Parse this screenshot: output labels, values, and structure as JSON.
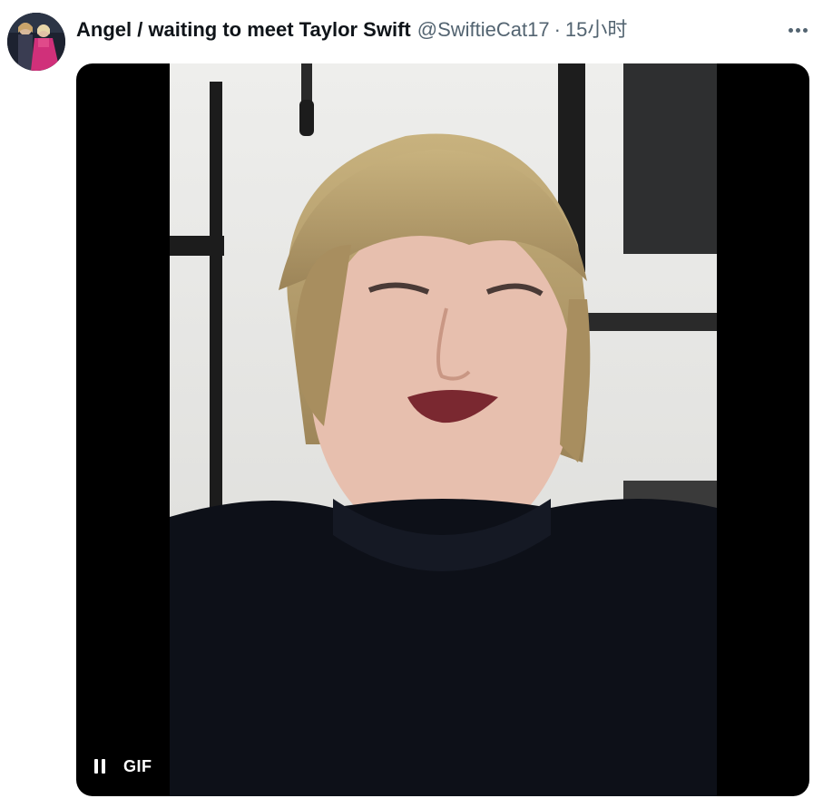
{
  "tweet": {
    "author_name": "Angel / waiting to meet Taylor Swift",
    "handle": "@SwiftieCat17",
    "separator": "·",
    "timestamp": "15小时",
    "more_icon": "more-horizontal-icon"
  },
  "media": {
    "type": "gif",
    "badge": "GIF",
    "pause_icon": "pause-icon"
  },
  "colors": {
    "name": "#0f1419",
    "secondary": "#536471",
    "media_background": "#000000",
    "badge_text": "#ffffff"
  }
}
